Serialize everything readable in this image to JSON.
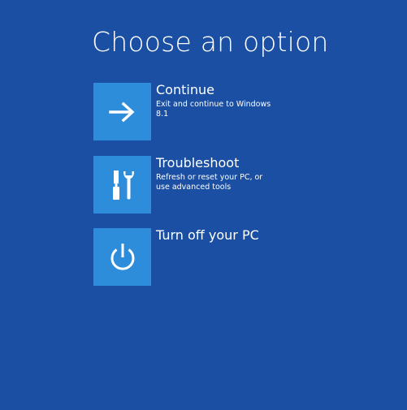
{
  "screen": {
    "title": "Choose an option",
    "background_color": "#1a4fa3",
    "tile_color": "#2e8ddb"
  },
  "options": [
    {
      "label": "Continue",
      "description": "Exit and continue to Windows 8.1",
      "icon": "arrow-right-icon"
    },
    {
      "label": "Troubleshoot",
      "description": "Refresh or reset your PC, or use advanced tools",
      "icon": "tools-icon"
    },
    {
      "label": "Turn off your PC",
      "description": "",
      "icon": "power-icon"
    }
  ]
}
